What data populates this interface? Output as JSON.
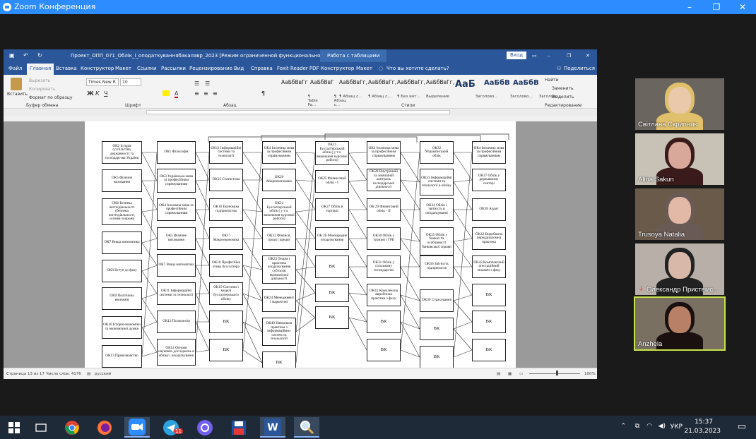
{
  "zoom": {
    "title": "Zoom Конференция"
  },
  "word": {
    "title": "Проект_ОПП_071_Облік_і_оподаткуваннябакалавр_2023 [Режим ограниченной функциональности] - Word",
    "context_tab": "Работа с таблицами",
    "signin": "Вход",
    "menu": [
      "Файл",
      "Главная",
      "Вставка",
      "Конструктор",
      "Макет",
      "Ссылки",
      "Рассылки",
      "Рецензирование",
      "Вид",
      "Справка",
      "Foxit Reader PDF",
      "Конструктор",
      "Макет"
    ],
    "tell_me": "Что вы хотите сделать?",
    "share": "Поделиться",
    "clipboard": {
      "paste": "Вставить",
      "cut": "Вырезать",
      "copy": "Копировать",
      "format": "Формат по образцу",
      "group": "Буфер обмена"
    },
    "font": {
      "name": "Times New R",
      "size": "10",
      "group": "Шрифт"
    },
    "paragraph_group": "Абзац",
    "styles_group": "Стили",
    "styles": [
      {
        "preview": "АаБбВвГг",
        "name": "¶ Table Pa..."
      },
      {
        "preview": "АаБбВвГ",
        "name": "¶ Абзац с..."
      },
      {
        "preview": "АаБбВвГг,",
        "name": "¶ Абзац с..."
      },
      {
        "preview": "АаБбВвГг,",
        "name": "¶ Абзац с..."
      },
      {
        "preview": "АаБбВвГг,",
        "name": "¶ Без инт..."
      },
      {
        "preview": "АаБбВвГг,",
        "name": "Выделение"
      },
      {
        "preview": "АаБ",
        "name": "Заголово..."
      },
      {
        "preview": "АаБбВ",
        "name": "Заголово..."
      },
      {
        "preview": "АаБбВ",
        "name": "Заголово..."
      }
    ],
    "editing": {
      "find": "Найти",
      "replace": "Заменить",
      "select": "Выделить",
      "group": "Редактирование"
    },
    "status": {
      "page": "Страница 13 из 17",
      "words": "Число слов: 4176",
      "lang": "русский",
      "zoom": "100%"
    }
  },
  "diagram": {
    "col1": [
      "ОК2 Історія суспільства, державності та господарства України",
      "ОК5 Фізичне виховання",
      "ОК6 Безпека життєдіяльності (безпека життєдіяльності, основи охорони",
      "ОК7 Вища математика",
      "ОК8 Вступ до фаху",
      "ОК9 Політична економія",
      "ОК10 Історія економіки та економічної думки",
      "ОК13 Правознавство"
    ],
    "col2": [
      "ОК1 Філософія",
      "ОК3 Українська мова за професійним спрямуванням",
      "ОК4 Іноземна мова за професійним спрямуванням",
      "ОК5 Фізичне виховання",
      "ОК7 Вища математика",
      "ОК11 Інформаційні системи та технології",
      "ОК12 Психологія",
      "ОК14 Основи наукових досліджень в обліку і оподаткуванні"
    ],
    "col3": [
      "ОК11 Інформаційні системи та технології",
      "ОК15 Статистика",
      "ОК16 Економіка підприємства",
      "ОК17 Макроекономіка",
      "ОК18 Професійна етика бухгалтера",
      "ОК19 Системи і моделі бухгалтерського обліку",
      "ВК",
      "ВК"
    ],
    "col4": [
      "ОК4 Іноземна мова за професійним спрямуванням",
      "ОК20 Мікроекономіка",
      "ОК21 Бухгалтерський облік ( у т.ч. виконання курсової роботи)",
      "ОК22 Фінанси, гроші і кредит",
      "ОК23 Теорія і практика оподаткування суб'єктів економічної діяльності",
      "ОК24 Менеджмент і маркетинг",
      "ОК40 Навчальна практика з інформаційних систем та технологій",
      "ВК"
    ],
    "col5": [
      "ОК21 Бухгалтерський облік ( у т.ч. виконання курсової роботи)",
      "ОК25 Фінансовий облік - І",
      "ОК27 Облік в торгівлі",
      "ОК 26 Міжнародне оподаткування",
      "ВК",
      "ВК",
      "ВК"
    ],
    "col6": [
      "ОК4 Іноземна мова за професійним спрямуванням",
      "ОК28 Внутрішній та зовнішній контроль господарської діяльності",
      "ОК 29 Фінансовий облік - ІІ",
      "ОК30 Облік у туризмі і ГРБ",
      "ОК31 Облік у сільському господарстві",
      "ОК41 Комплексна виробнича практика з фаху",
      "ВК",
      "ВК"
    ],
    "col7": [
      "ОК32 Управлінський облік",
      "ОК33 Інформаційні системи та технології в обліку",
      "ОК34 Облік і звітність в оподаткуванні",
      "ОК35 Облік у банках та особливості банківської справи",
      "ОК36 Звітність підприємств",
      "ОК39 Страхування",
      "ВК",
      "ВК"
    ],
    "col8": [
      "ОК4 Іноземна мова за професійним спрямуванням",
      "ОК37 Облік у державному секторі",
      "ОК38 Аудит",
      "ОК42 Виробнича переддипломна практика",
      "ОК43 Комплексний атестаційний екзамен з фаху",
      "ВК",
      "ВК",
      "ВК"
    ]
  },
  "participants": [
    {
      "name": "Світлана Скрипник",
      "colors": [
        "#6b6560",
        "#e9c9a9",
        "#e0c06a"
      ]
    },
    {
      "name": "Alina Sakun",
      "colors": [
        "#c8c2b6",
        "#d8a89a",
        "#3a1a1a"
      ]
    },
    {
      "name": "Trusoya Natalia",
      "colors": [
        "#6a5a4a",
        "#e2b8a6",
        "#6a5a55"
      ]
    },
    {
      "name": "Олександр Пристемс...",
      "colors": [
        "#b8b0a8",
        "#d8b8a8",
        "#222"
      ]
    },
    {
      "name": "Anzhela",
      "colors": [
        "#7a7062",
        "#b88066",
        "#1a1010"
      ]
    }
  ],
  "tray": {
    "lang": "УКР",
    "time": "15:37",
    "date": "21.03.2023",
    "badge": "11"
  }
}
